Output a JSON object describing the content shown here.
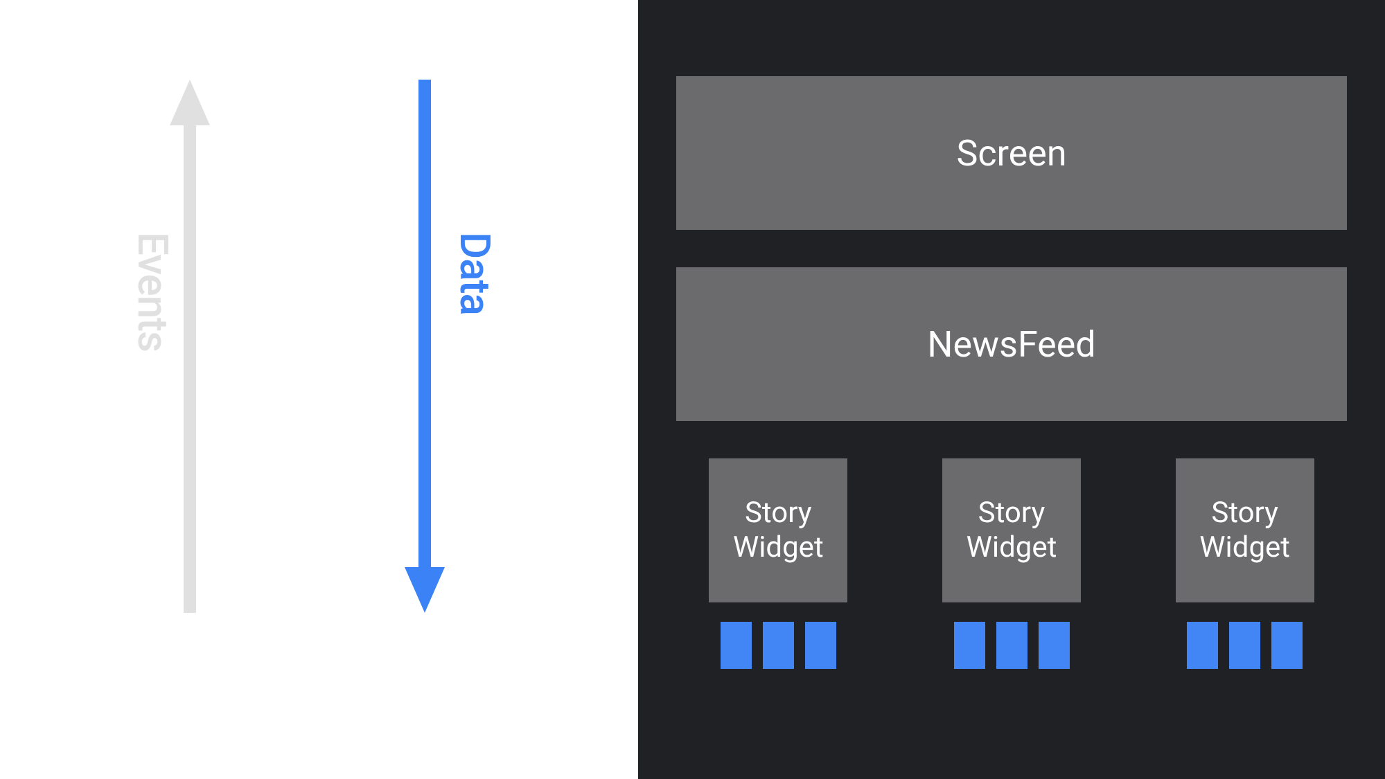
{
  "arrows": {
    "events_label": "Events",
    "data_label": "Data"
  },
  "hierarchy": {
    "screen": "Screen",
    "newsfeed": "NewsFeed",
    "widgets": [
      {
        "line1": "Story",
        "line2": "Widget"
      },
      {
        "line1": "Story",
        "line2": "Widget"
      },
      {
        "line1": "Story",
        "line2": "Widget"
      }
    ]
  },
  "colors": {
    "blue": "#4285f4",
    "light_gray": "#e0e0e0",
    "box_gray": "#6b6b6d",
    "dark_bg": "#202124"
  }
}
